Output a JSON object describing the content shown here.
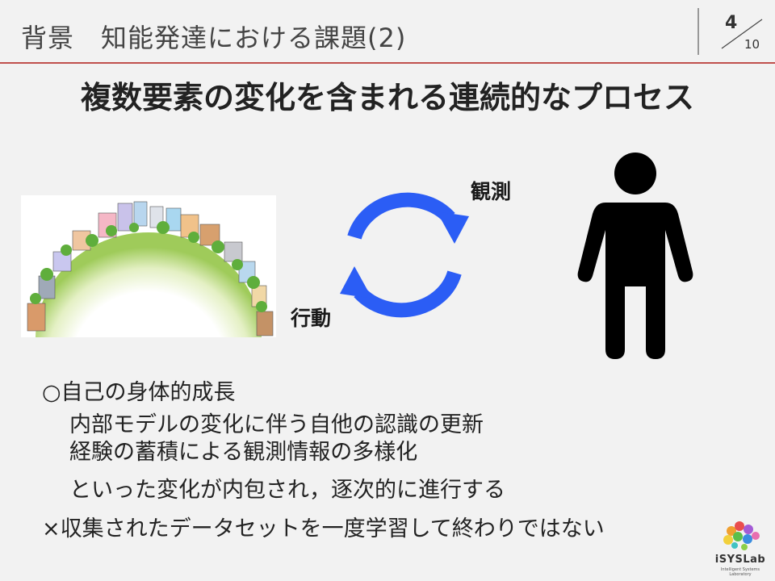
{
  "header": {
    "title": "背景　知能発達における課題(2)",
    "page_current": "4",
    "page_total": "10",
    "accent_color": "#c0504d"
  },
  "main": {
    "heading": "複数要素の変化を含まれる連続的なプロセス",
    "diagram": {
      "label_observe": "観測",
      "label_action": "行動",
      "arrow_color": "#2b5df5",
      "icons": [
        "world-city-illustration",
        "cycle-arrows-icon",
        "person-icon"
      ]
    },
    "body_lines": [
      "○自己の身体的成長",
      "内部モデルの変化に伴う自他の認識の更新",
      "経験の蓄積による観測情報の多様化",
      "といった変化が内包され，逐次的に進行する",
      "×収集されたデータセットを一度学習して終わりではない"
    ]
  },
  "logo": {
    "text": "iSYSLab",
    "subtext": "Intelligent Systems Laboratory"
  }
}
